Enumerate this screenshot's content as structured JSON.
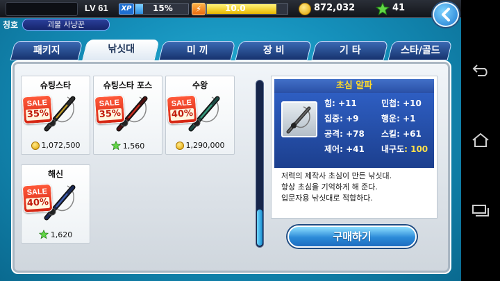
{
  "topbar": {
    "level": "LV 61",
    "xp_label": "XP",
    "xp_percent_text": "15%",
    "xp_fraction": 0.15,
    "energy_text": "10.0",
    "energy_fraction": 0.86,
    "gold": "872,032",
    "stars": "41"
  },
  "title": {
    "label": "칭호",
    "value": "괴물 사냥꾼"
  },
  "tabs": [
    "패키지",
    "낚싯대",
    "미 끼",
    "장 비",
    "기 타",
    "스타/골드"
  ],
  "active_tab": 1,
  "items": [
    {
      "name": "슈팅스타",
      "sale_label": "SALE",
      "sale_pct": "35%",
      "price": "1,072,500",
      "currency": "gold",
      "rod_color": "#2a2a2a",
      "accent": "#c9a020"
    },
    {
      "name": "슈팅스타 포스",
      "sale_label": "SALE",
      "sale_pct": "35%",
      "price": "1,560",
      "currency": "star",
      "rod_color": "#4a1010",
      "accent": "#d03020"
    },
    {
      "name": "수왕",
      "sale_label": "SALE",
      "sale_pct": "40%",
      "price": "1,290,000",
      "currency": "gold",
      "rod_color": "#1e4b45",
      "accent": "#3aa080"
    },
    {
      "name": "해신",
      "sale_label": "SALE",
      "sale_pct": "40%",
      "price": "1,620",
      "currency": "star",
      "rod_color": "#1c2a55",
      "accent": "#4060b0"
    }
  ],
  "detail": {
    "title": "초심 알파",
    "stats": [
      {
        "label": "힘",
        "value": ": +11"
      },
      {
        "label": "민첩",
        "value": ": +10"
      },
      {
        "label": "집중",
        "value": ": +9"
      },
      {
        "label": "행운",
        "value": ": +1"
      },
      {
        "label": "공격",
        "value": ": +78"
      },
      {
        "label": "스킬",
        "value": ": +61"
      },
      {
        "label": "제어",
        "value": ": +41"
      },
      {
        "label": "내구도",
        "value": ": 100"
      }
    ],
    "description": [
      "저력의 제작사 초심이 만든 낚싯대.",
      "항상 초심을 기억하게 해 준다.",
      "입문자용 낚싯대로 적합하다."
    ],
    "buy_label": "구매하기"
  },
  "colors": {
    "accent_blue": "#2b8ad8",
    "sale_red": "#d42412",
    "highlight_yellow": "#ffe14a"
  }
}
